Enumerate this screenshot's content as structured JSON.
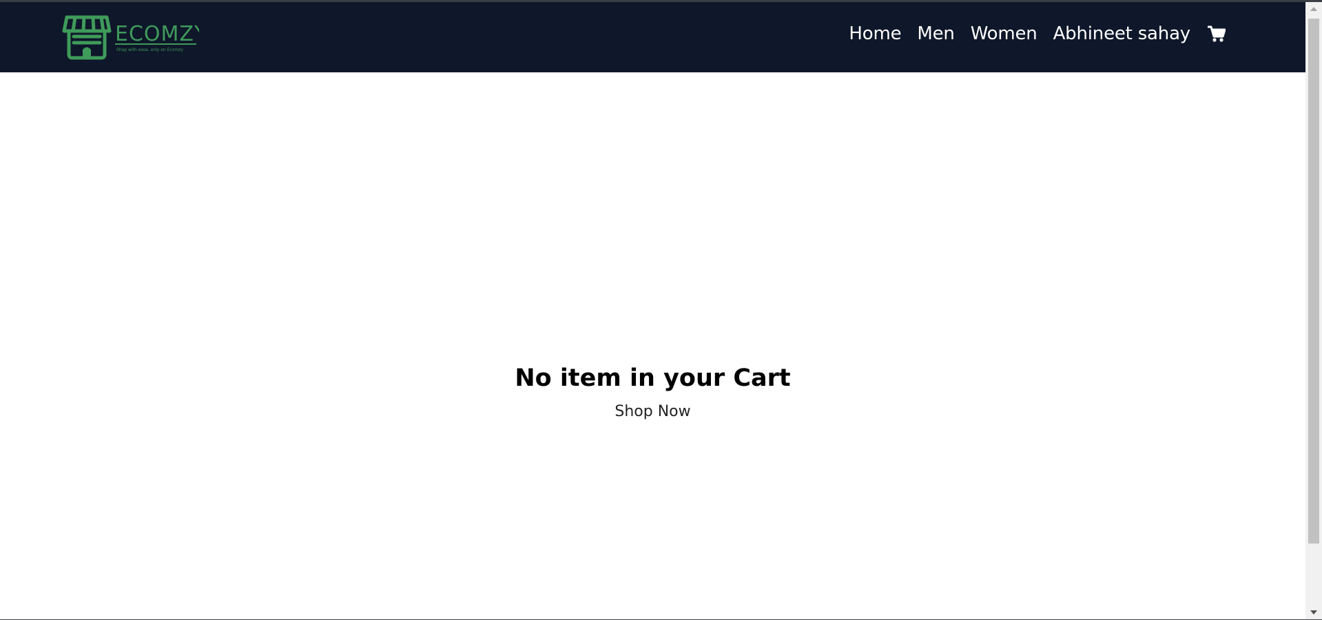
{
  "brand": {
    "name": "ECOMZY",
    "tagline": "Shop with ease, only on Ecomzy",
    "color": "#3f9b5a"
  },
  "navbar": {
    "background": "#0f172a",
    "links": [
      {
        "label": "Home"
      },
      {
        "label": "Men"
      },
      {
        "label": "Women"
      },
      {
        "label": "Abhineet sahay"
      }
    ],
    "cart_icon": "shopping-cart-icon"
  },
  "cart": {
    "empty_title": "No item in your Cart",
    "shop_now_label": "Shop Now"
  }
}
